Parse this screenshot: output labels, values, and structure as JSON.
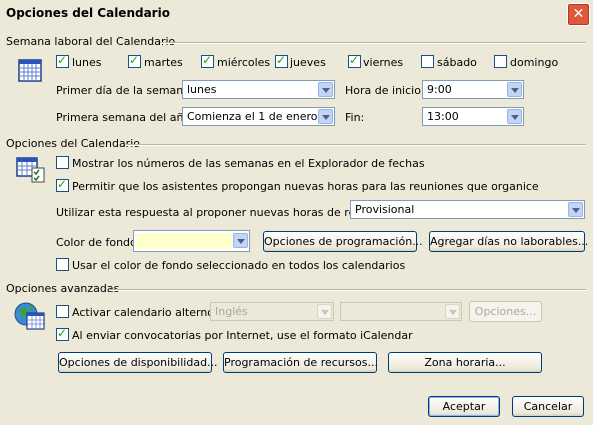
{
  "window": {
    "title": "Opciones del Calendario",
    "close": "✕"
  },
  "work_week": {
    "heading": "Semana laboral del Calendario",
    "days": [
      {
        "label": "lunes",
        "checked": true
      },
      {
        "label": "martes",
        "checked": true
      },
      {
        "label": "miércoles",
        "checked": true
      },
      {
        "label": "jueves",
        "checked": true
      },
      {
        "label": "viernes",
        "checked": true
      },
      {
        "label": "sábado",
        "checked": false
      },
      {
        "label": "domingo",
        "checked": false
      }
    ],
    "first_day_label": "Primer día de la semana:",
    "first_day_value": "lunes",
    "first_week_label": "Primera semana del año:",
    "first_week_value": "Comienza el 1 de enero",
    "start_label": "Hora de inicio:",
    "start_value": "9:00",
    "end_label": "Fin:",
    "end_value": "13:00"
  },
  "calendar_options": {
    "heading": "Opciones del Calendario",
    "show_week_numbers": "Mostrar los números de las semanas en el Explorador de fechas",
    "allow_propose": "Permitir que los asistentes propongan nuevas horas para las reuniones que organice",
    "response_label": "Utilizar esta respuesta al proponer nuevas horas de reunión:",
    "response_value": "Provisional",
    "bg_color_label": "Color de fondo:",
    "bg_color_value": "#ffffcc",
    "scheduling_button": "Opciones de programación...",
    "add_holidays_button": "Agregar días no laborables...",
    "use_bg_all": "Usar el color de fondo seleccionado en todos los calendarios"
  },
  "advanced": {
    "heading": "Opciones avanzadas",
    "alt_calendar_label": "Activar calendario alterno:",
    "alt_calendar_lang": "Inglés",
    "alt_calendar_type": "",
    "options_button": "Opciones...",
    "icalendar_label": "Al enviar convocatorias por Internet, use el formato iCalendar",
    "free_busy_button": "Opciones de disponibilidad...",
    "resource_button": "Programación de recursos...",
    "timezone_button": "Zona horaria..."
  },
  "footer": {
    "ok": "Aceptar",
    "cancel": "Cancelar"
  }
}
